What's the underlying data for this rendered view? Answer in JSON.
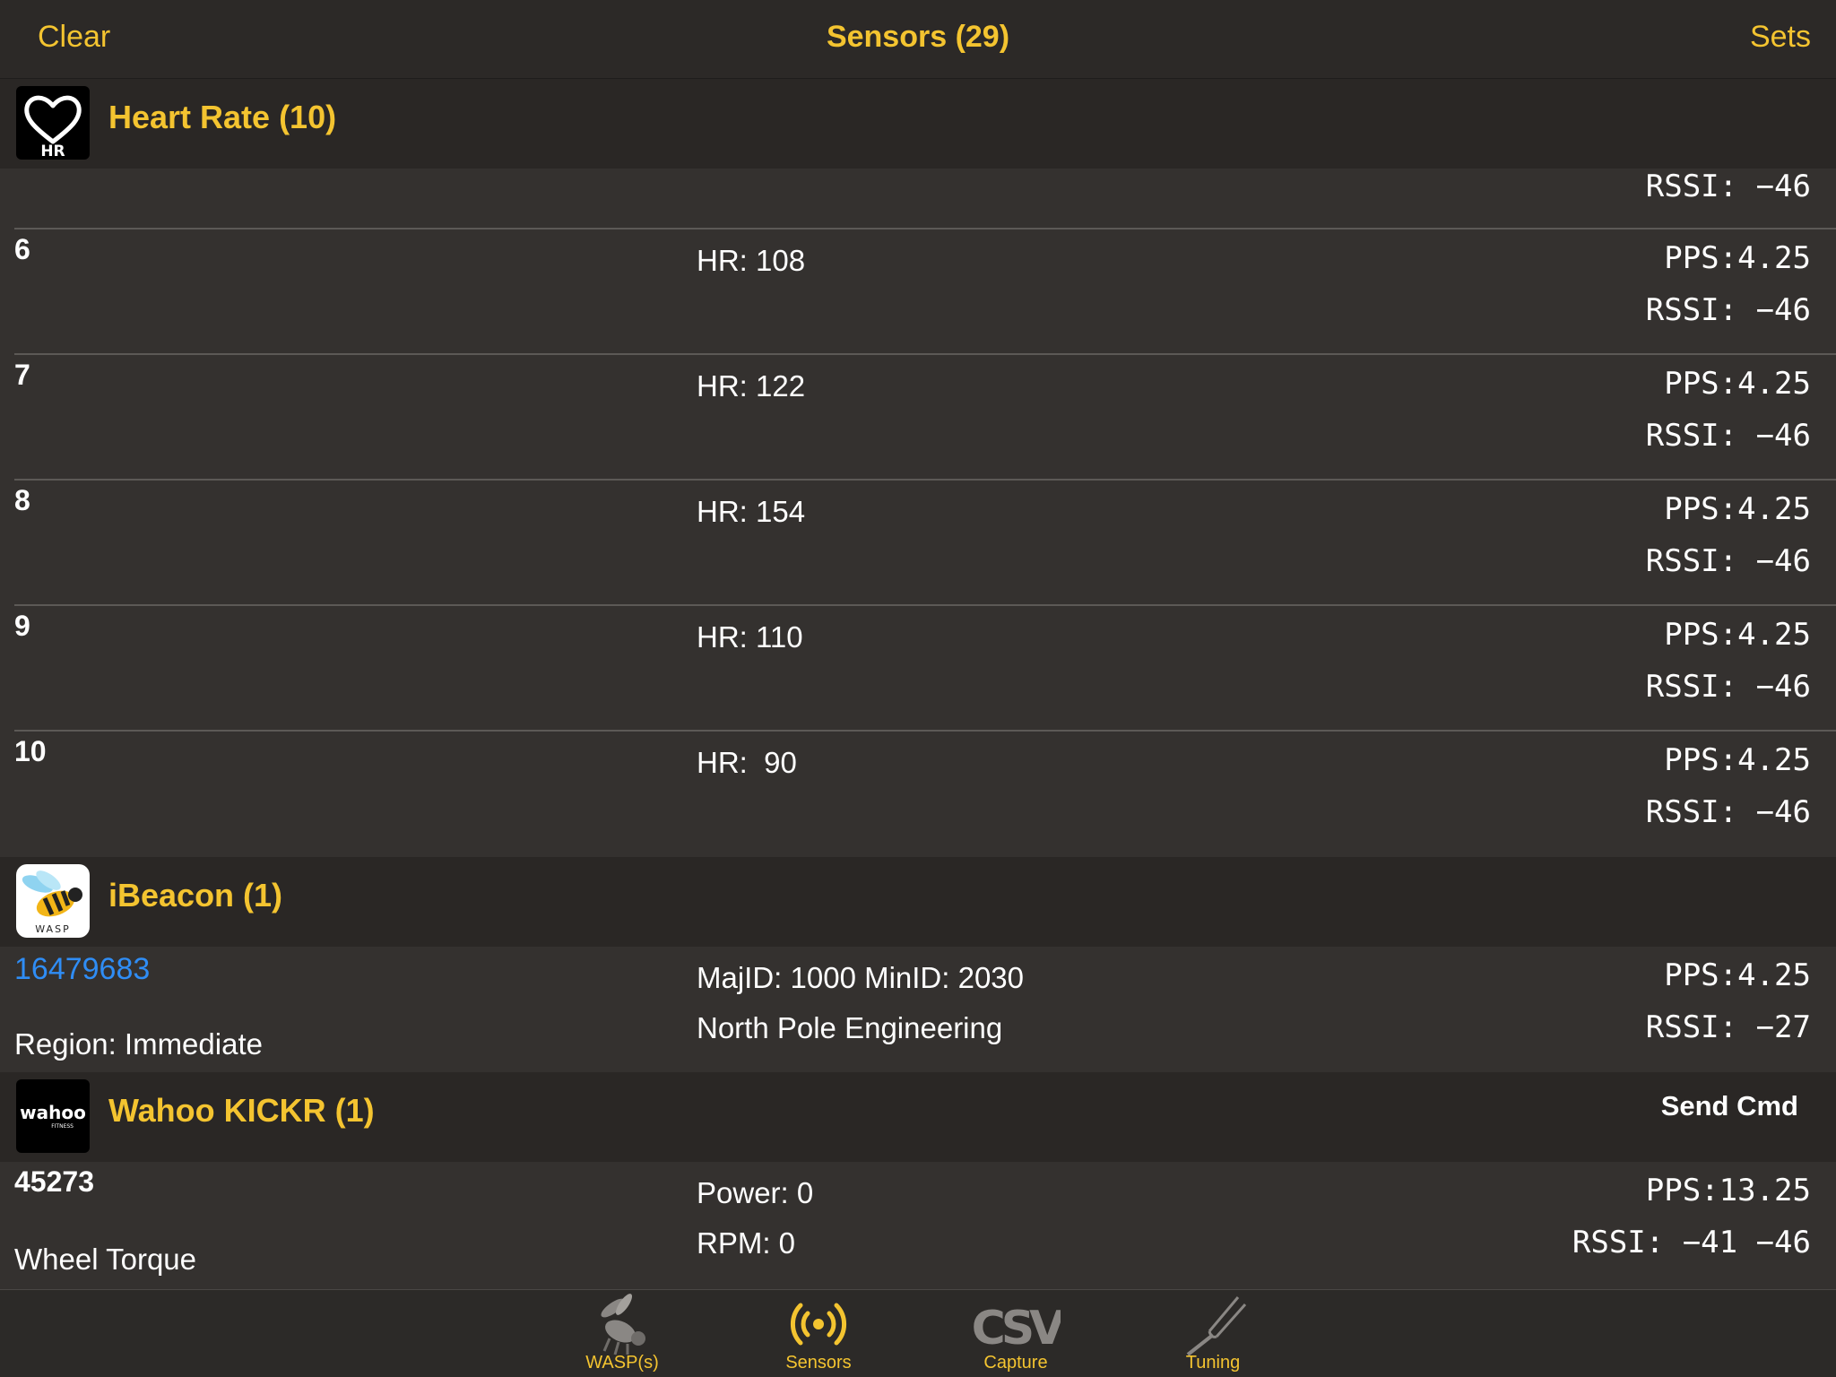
{
  "nav": {
    "left": "Clear",
    "title": "Sensors (29)",
    "right": "Sets"
  },
  "colors": {
    "accent": "#f4c430",
    "link": "#2f8df5",
    "background": "#2f2c2a"
  },
  "sections": {
    "heart_rate": {
      "title": "Heart Rate (10)",
      "icon": "hr-heart-icon",
      "icon_text": "HR",
      "partial_row": {
        "rssi": "RSSI: −46"
      },
      "rows": [
        {
          "id": "6",
          "hr": "HR: 108",
          "pps": "PPS:4.25",
          "rssi": "RSSI: −46"
        },
        {
          "id": "7",
          "hr": "HR: 122",
          "pps": "PPS:4.25",
          "rssi": "RSSI: −46"
        },
        {
          "id": "8",
          "hr": "HR: 154",
          "pps": "PPS:4.25",
          "rssi": "RSSI: −46"
        },
        {
          "id": "9",
          "hr": "HR: 110",
          "pps": "PPS:4.25",
          "rssi": "RSSI: −46"
        },
        {
          "id": "10",
          "hr": "HR:  90",
          "pps": "PPS:4.25",
          "rssi": "RSSI: −46"
        }
      ]
    },
    "ibeacon": {
      "title": "iBeacon (1)",
      "icon": "wasp-app-icon",
      "icon_text": "WASP",
      "row": {
        "id": "16479683",
        "region": "Region: Immediate",
        "ids": "MajID: 1000 MinID: 2030",
        "maker": "North Pole Engineering",
        "pps": "PPS:4.25",
        "rssi": "RSSI: −27"
      }
    },
    "kickr": {
      "title": "Wahoo KICKR (1)",
      "icon": "wahoo-logo-icon",
      "icon_text": "wahoo",
      "icon_subtext": "FITNESS",
      "send_cmd": "Send Cmd",
      "row": {
        "id": "45273",
        "mode": "Wheel Torque",
        "power": "Power: 0",
        "rpm": "RPM: 0",
        "pps": "PPS:13.25",
        "rssi": "RSSI: −41 −46"
      }
    }
  },
  "tabs": [
    {
      "label": "WASP(s)",
      "icon": "wasp-icon"
    },
    {
      "label": "Sensors",
      "icon": "broadcast-icon"
    },
    {
      "label": "Capture",
      "icon": "csv-icon",
      "icon_text": "CSV"
    },
    {
      "label": "Tuning",
      "icon": "tuning-fork-icon"
    }
  ]
}
